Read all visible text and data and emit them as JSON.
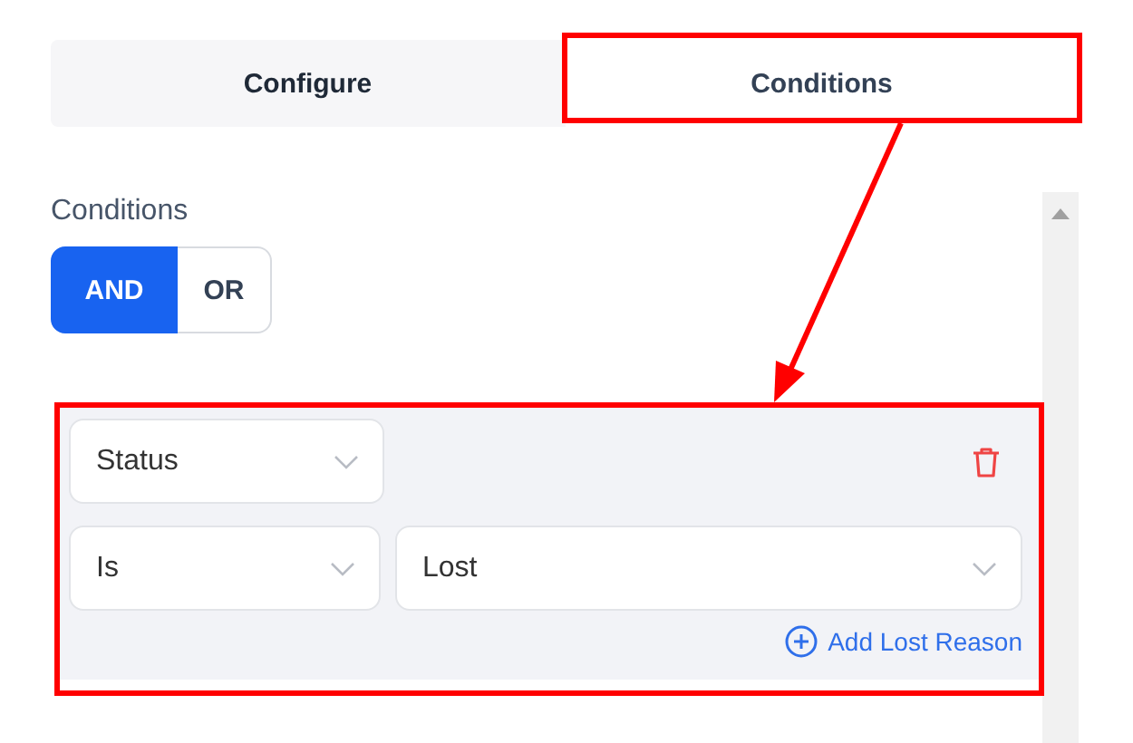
{
  "tabs": [
    {
      "label": "Configure",
      "selected": false
    },
    {
      "label": "Conditions",
      "selected": true
    }
  ],
  "section_label": "Conditions",
  "logic_toggle": [
    {
      "label": "AND",
      "selected": true
    },
    {
      "label": "OR",
      "selected": false
    }
  ],
  "condition": {
    "field": "Status",
    "operator": "Is",
    "value": "Lost",
    "add_link": "Add Lost Reason"
  }
}
